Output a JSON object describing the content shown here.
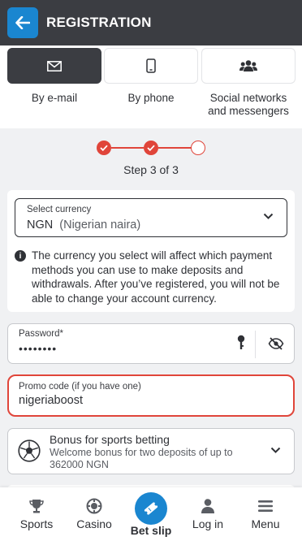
{
  "header": {
    "title": "REGISTRATION"
  },
  "methods": [
    {
      "label": "By e-mail",
      "icon": "envelope-icon",
      "active": true
    },
    {
      "label": "By phone",
      "icon": "phone-icon",
      "active": false
    },
    {
      "label": "Social networks and messengers",
      "icon": "users-icon",
      "active": false
    }
  ],
  "stepper": {
    "text": "Step 3 of 3",
    "current": 3,
    "total": 3,
    "color": "#e0453a"
  },
  "currency": {
    "label": "Select currency",
    "code": "NGN",
    "name": "(Nigerian naira)",
    "info": "The currency you select will affect which payment methods you can use to make deposits and withdrawals. After you’ve registered, you will not be able to change your account currency."
  },
  "password": {
    "label": "Password*",
    "value": "••••••••"
  },
  "promo": {
    "label": "Promo code (if you have one)",
    "value": "nigeriaboost"
  },
  "bonus": {
    "title": "Bonus for sports betting",
    "description": "Welcome bonus for two deposits of up to 362000 NGN",
    "icon": "soccer-ball-icon"
  },
  "nav": {
    "sports": "Sports",
    "casino": "Casino",
    "betslip": "Bet slip",
    "login": "Log in",
    "menu": "Menu"
  },
  "colors": {
    "header": "#3b3d42",
    "accent": "#1a86d0",
    "error": "#e0453a"
  }
}
